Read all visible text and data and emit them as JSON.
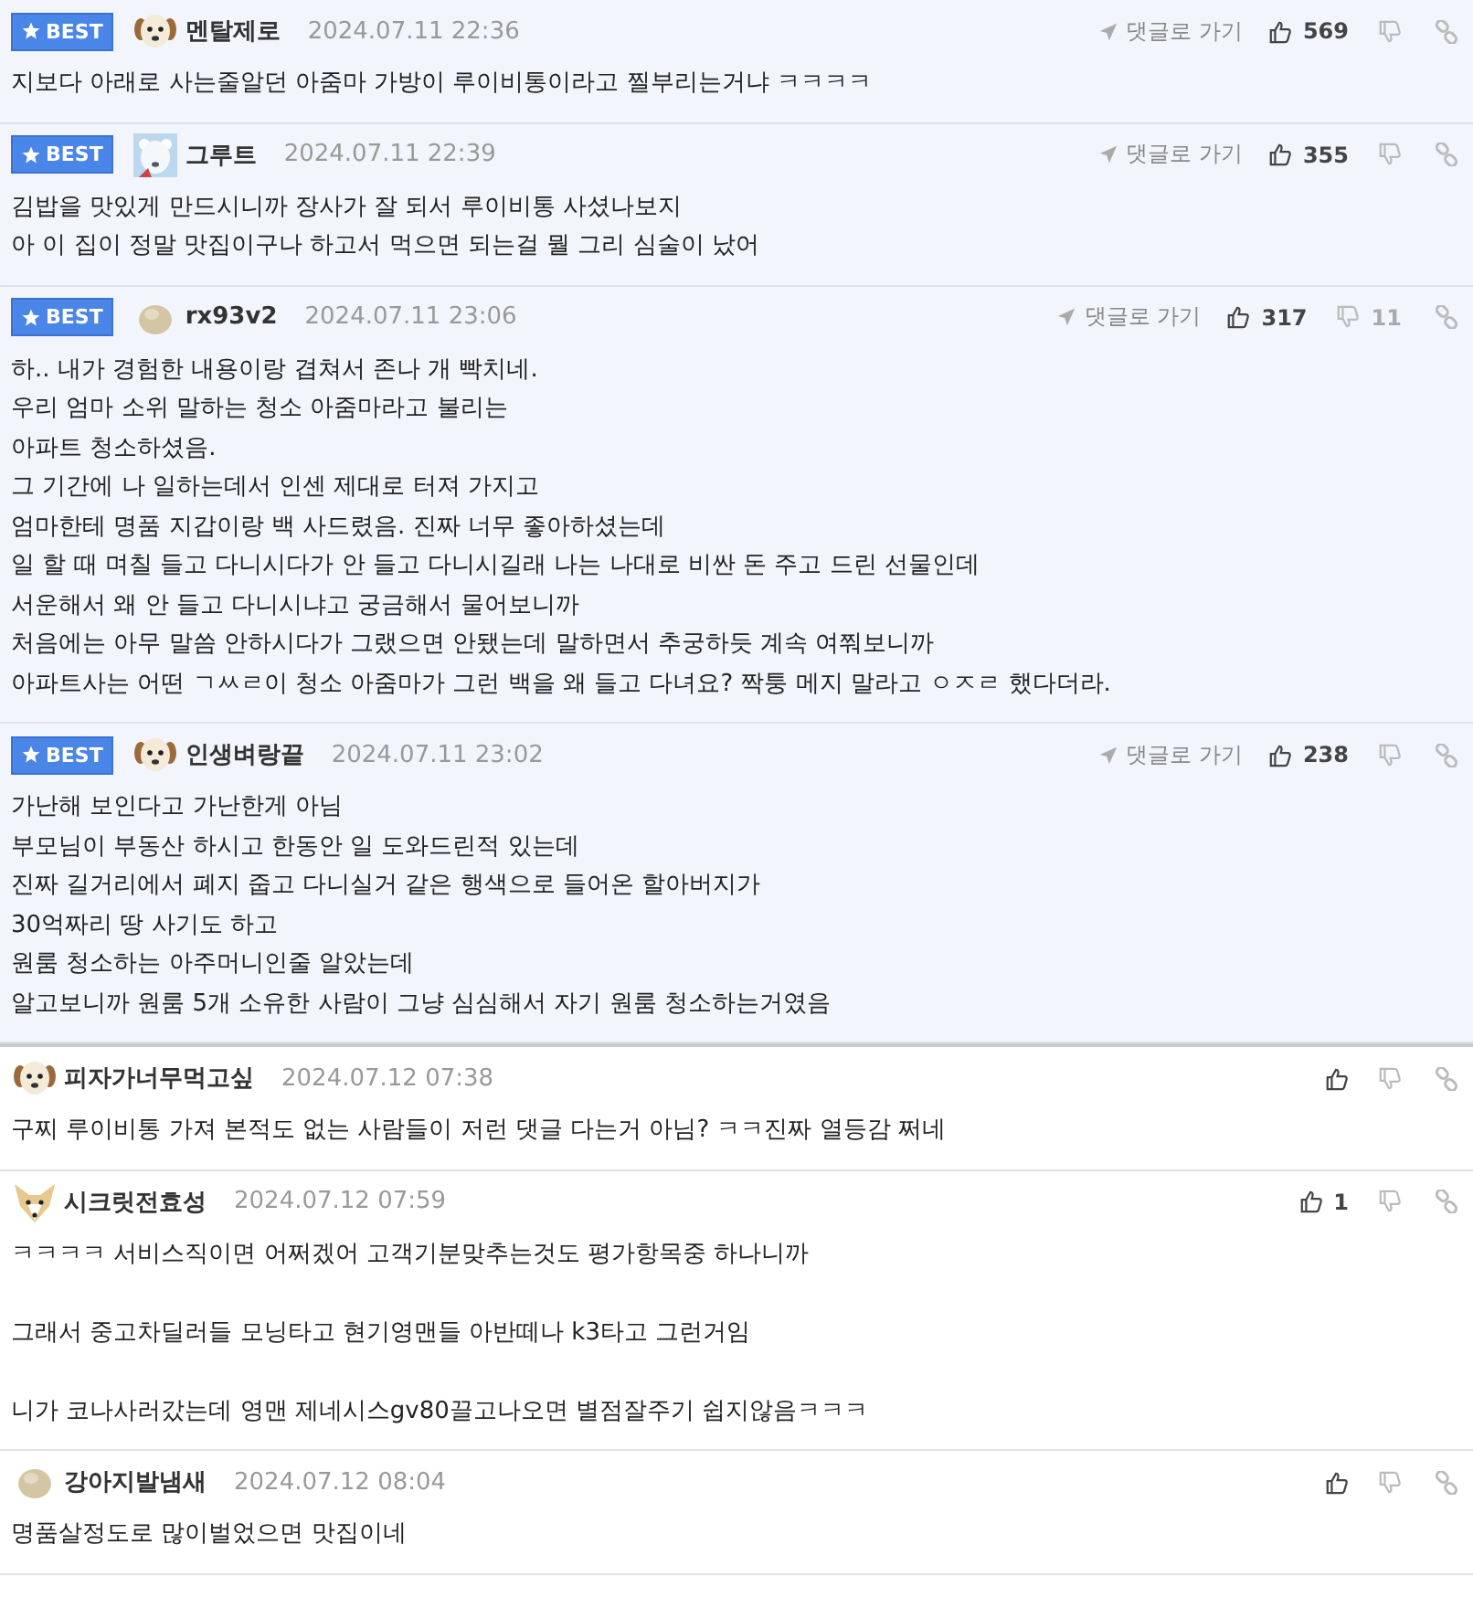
{
  "comments": [
    {
      "best": true,
      "badge": "BEST",
      "nickname": "멘탈제로",
      "date": "2024.07.11 22:36",
      "goto": "댓글로 가기",
      "up": "569",
      "paragraphs": [
        [
          "지보다 아래로 사는줄알던 아줌마 가방이 루이비통이라고 찔부리는거냐 ㅋㅋㅋㅋ"
        ]
      ]
    },
    {
      "best": true,
      "badge": "BEST",
      "nickname": "그루트",
      "date": "2024.07.11 22:39",
      "goto": "댓글로 가기",
      "up": "355",
      "paragraphs": [
        [
          "김밥을 맛있게 만드시니까 장사가 잘 되서 루이비통 사셨나보지",
          "아 이 집이 정말 맛집이구나 하고서 먹으면 되는걸 뭘 그리 심술이 났어"
        ]
      ]
    },
    {
      "best": true,
      "badge": "BEST",
      "nickname": "rx93v2",
      "date": "2024.07.11 23:06",
      "goto": "댓글로 가기",
      "up": "317",
      "down": "11",
      "paragraphs": [
        [
          "하.. 내가 경험한 내용이랑 겹쳐서 존나 개 빡치네.",
          "우리 엄마 소위 말하는 청소 아줌마라고 불리는",
          "아파트 청소하셨음.",
          "그 기간에 나 일하는데서 인센 제대로 터져 가지고",
          "엄마한테 명품 지갑이랑 백 사드렸음. 진짜 너무 좋아하셨는데",
          "일 할 때 며칠 들고 다니시다가 안 들고 다니시길래 나는 나대로 비싼 돈 주고 드린 선물인데",
          "서운해서 왜 안 들고 다니시냐고 궁금해서 물어보니까",
          "처음에는 아무 말씀 안하시다가 그랬으면 안됐는데 말하면서 추궁하듯 계속 여쭤보니까",
          "아파트사는 어떤 ㄱㅆㄹ이 청소 아줌마가 그런 백을 왜 들고 다녀요? 짝퉁 메지 말라고 ㅇㅈㄹ 했다더라."
        ]
      ]
    },
    {
      "best": true,
      "badge": "BEST",
      "nickname": "인생벼랑끝",
      "date": "2024.07.11 23:02",
      "goto": "댓글로 가기",
      "up": "238",
      "paragraphs": [
        [
          "가난해 보인다고 가난한게 아님",
          "부모님이 부동산 하시고 한동안 일 도와드린적 있는데",
          "진짜 길거리에서 폐지 줍고 다니실거 같은 행색으로 들어온 할아버지가",
          "30억짜리 땅 사기도 하고",
          "원룸 청소하는 아주머니인줄 알았는데",
          "알고보니까 원룸 5개 소유한 사람이 그냥 심심해서 자기 원룸 청소하는거였음"
        ]
      ]
    },
    {
      "best": false,
      "nickname": "피자가너무먹고싶",
      "date": "2024.07.12 07:38",
      "paragraphs": [
        [
          "구찌 루이비통 가져 본적도 없는 사람들이 저런 댓글 다는거 아님? ㅋㅋ진짜 열등감 쩌네"
        ]
      ]
    },
    {
      "best": false,
      "nickname": "시크릿전효성",
      "date": "2024.07.12 07:59",
      "up": "1",
      "paragraphs": [
        [
          "ㅋㅋㅋㅋ 서비스직이면 어쩌겠어 고객기분맞추는것도 평가항목중 하나니까"
        ],
        [
          "그래서 중고차딜러들 모닝타고 현기영맨들 아반떼나 k3타고 그런거임"
        ],
        [
          "니가 코나사러갔는데 영맨 제네시스gv80끌고나오면 별점잘주기 쉽지않음ㅋㅋㅋ"
        ]
      ]
    },
    {
      "best": false,
      "nickname": "강아지발냄새",
      "date": "2024.07.12 08:04",
      "paragraphs": [
        [
          "명품살정도로 많이벌었으면 맛집이네"
        ]
      ]
    }
  ]
}
